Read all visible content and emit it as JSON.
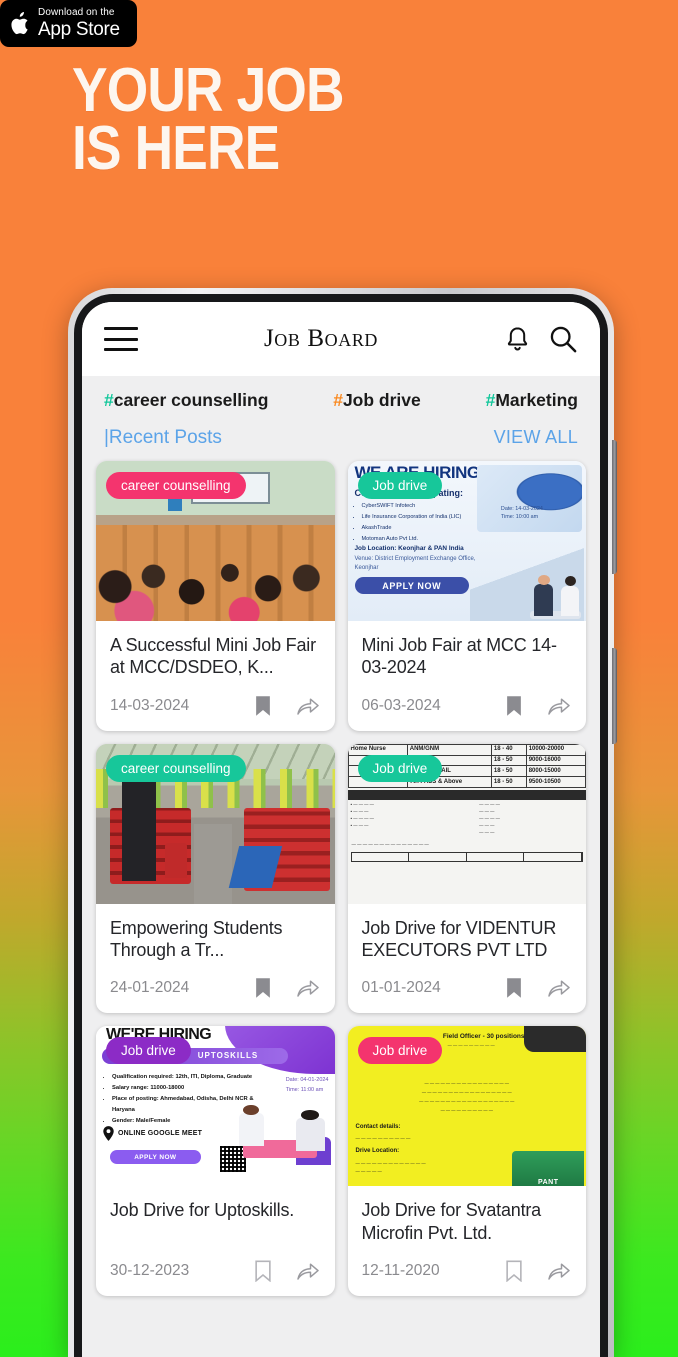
{
  "promo": {
    "appstore": {
      "small_text": "Download on the",
      "big_text": "App Store",
      "icon": "apple-logo-icon"
    },
    "headline_line1": "YOUR JOB",
    "headline_line2": "IS HERE"
  },
  "colors": {
    "bg_top": "#f9813a",
    "bg_bottom": "#2bee1c",
    "badge_pink": "#f4346e",
    "badge_teal": "#17c79a",
    "badge_purple": "#8c2bc6",
    "link_blue": "#5ba3e8",
    "hash_teal": "#13c79b",
    "hash_orange": "#f98a22"
  },
  "app": {
    "header": {
      "title": "Job Board",
      "menu_icon": "hamburger-menu-icon",
      "bell_icon": "notification-bell-icon",
      "search_icon": "search-icon"
    },
    "tags": [
      {
        "hash": "#",
        "label": "career counselling",
        "hash_color": "teal"
      },
      {
        "hash": "#",
        "label": "Job drive",
        "hash_color": "orange"
      },
      {
        "hash": "#",
        "label": "Marketing",
        "hash_color": "teal"
      }
    ],
    "section": {
      "recent_label": "|Recent Posts",
      "view_all_label": "VIEW ALL"
    },
    "cards": [
      {
        "badge": "career counselling",
        "badge_color": "pink",
        "title": "A Successful Mini Job Fair at MCC/DSDEO, K...",
        "date": "14-03-2024",
        "bookmark_state": "filled",
        "bookmark_icon": "bookmark-icon",
        "share_icon": "share-icon",
        "art": "classroom-photo"
      },
      {
        "badge": "Job drive",
        "badge_color": "teal",
        "title": "Mini Job Fair at MCC 14-03-2024",
        "date": "06-03-2024",
        "bookmark_state": "filled",
        "bookmark_icon": "bookmark-icon",
        "share_icon": "share-icon",
        "art": "hiring-poster",
        "poster": {
          "heading": "WE ARE HIRING!",
          "subheading": "Companies Participating:",
          "companies": [
            "CyberSWIFT Infotech",
            "Life Insurance Corporation of India (LIC)",
            "AkashTrade",
            "Motoman Auto Pvt Ltd."
          ],
          "location": "Job Location: Keonjhar & PAN India",
          "venue": "Venue: District Employment Exchange Office, Keonjhar",
          "date_line": "Date: 14-03-2024",
          "time_line": "Time: 10:00 am",
          "cta": "APPLY NOW"
        }
      },
      {
        "badge": "career counselling",
        "badge_color": "teal",
        "title": "Empowering Students Through a Tr...",
        "date": "24-01-2024",
        "bookmark_state": "filled",
        "bookmark_icon": "bookmark-icon",
        "share_icon": "share-icon",
        "art": "assembly-hall-photo"
      },
      {
        "badge": "Job drive",
        "badge_color": "teal",
        "title": "Job Drive for VIDENTUR EXECUTORS PVT LTD",
        "date": "01-01-2024",
        "bookmark_state": "filled",
        "bookmark_icon": "bookmark-icon",
        "share_icon": "share-icon",
        "art": "newspaper-table",
        "table": {
          "rows": [
            {
              "role": "Home Nurse",
              "qual": "ANM/GNM",
              "age": "18 - 40",
              "pay": "10000-20000"
            },
            {
              "role": "",
              "qual": "Nursing",
              "age": "18 - 50",
              "pay": "9000-16000"
            },
            {
              "role": "",
              "qual": "5th PASS/FAIL",
              "age": "18 - 50",
              "pay": "8000-15000"
            },
            {
              "role": "",
              "qual": "7th PASS & Above",
              "age": "18 - 50",
              "pay": "9500-10500"
            }
          ]
        }
      },
      {
        "badge": "Job drive",
        "badge_color": "purple",
        "title": "Job Drive for Uptoskills.",
        "date": "30-12-2023",
        "bookmark_state": "outline",
        "bookmark_icon": "bookmark-icon",
        "share_icon": "share-icon",
        "art": "uptoskills-poster",
        "poster": {
          "heading": "WE'RE HIRING",
          "brand": "UPTOSKILLS",
          "bullets": [
            "Qualification required: 12th, ITI, Diploma, Graduate",
            "Salary range: 11000-18000",
            "Place of posting: Ahmedabad, Odisha, Delhi NCR & Haryana",
            "Gender: Male/Female"
          ],
          "date_line": "Date: 04-01-2024",
          "time_line": "Time: 11:00 am",
          "mode": "ONLINE GOOGLE MEET",
          "cta": "APPLY NOW"
        }
      },
      {
        "badge": "Job drive",
        "badge_color": "pink",
        "title": "Job Drive for Svatantra Microfin Pvt. Ltd.",
        "date": "12-11-2020",
        "bookmark_state": "outline",
        "bookmark_icon": "bookmark-icon",
        "share_icon": "share-icon",
        "art": "yellow-flyer",
        "poster": {
          "heading": "Field Officer - 30 positions",
          "contact_heading": "Contact details:",
          "location_heading": "Drive Location:"
        }
      }
    ]
  }
}
